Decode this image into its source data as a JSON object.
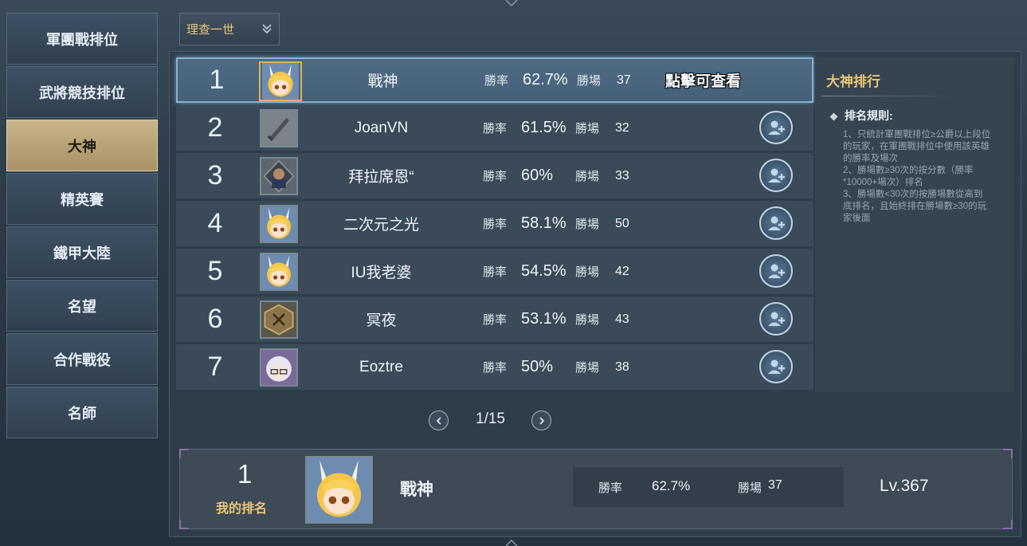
{
  "sidebar": {
    "items": [
      {
        "label": "軍團戰排位",
        "active": false
      },
      {
        "label": "武將競技排位",
        "active": false
      },
      {
        "label": "大神",
        "active": true
      },
      {
        "label": "精英賽",
        "active": false
      },
      {
        "label": "鐵甲大陸",
        "active": false
      },
      {
        "label": "名望",
        "active": false
      },
      {
        "label": "合作戰役",
        "active": false
      },
      {
        "label": "名師",
        "active": false
      }
    ]
  },
  "dropdown": {
    "value": "理查一世"
  },
  "ranking": {
    "rate_label": "勝率",
    "games_label": "勝場",
    "click_hint": "點擊可查看",
    "rows": [
      {
        "rank": "1",
        "name": "戰神",
        "rate": "62.7%",
        "games": "37",
        "avatar": "blonde-bunny-girl-avatar-icon"
      },
      {
        "rank": "2",
        "name": "JoanVN",
        "rate": "61.5%",
        "games": "32",
        "avatar": "sword-avatar-icon"
      },
      {
        "rank": "3",
        "name": "拜拉席恩“",
        "rate": "60%",
        "games": "33",
        "avatar": "armored-warrior-avatar-icon"
      },
      {
        "rank": "4",
        "name": "二次元之光",
        "rate": "58.1%",
        "games": "50",
        "avatar": "blonde-bunny-girl-avatar-icon"
      },
      {
        "rank": "5",
        "name": "IU我老婆",
        "rate": "54.5%",
        "games": "42",
        "avatar": "blonde-bunny-girl-avatar-icon"
      },
      {
        "rank": "6",
        "name": "冥夜",
        "rate": "53.1%",
        "games": "43",
        "avatar": "bronze-emblem-avatar-icon"
      },
      {
        "rank": "7",
        "name": "Eoztre",
        "rate": "50%",
        "games": "38",
        "avatar": "silver-hair-glasses-avatar-icon"
      }
    ]
  },
  "info": {
    "title": "大神排行",
    "rule_heading": "排名規則:",
    "rule_text": "1、只統計軍團戰排位≥公爵以上段位\n的玩家，在軍團戰排位中使用該英雄\n的勝率及場次\n2、勝場數≥30次的按分數（勝率\n*10000+場次）排名\n3、勝場數<30次的按勝場數從高到\n底排名，且始終排在勝場數≥30的玩\n家後面"
  },
  "pagination": {
    "text": "1/15"
  },
  "my_rank": {
    "rank": "1",
    "label": "我的排名",
    "name": "戰神",
    "rate_label": "勝率",
    "rate": "62.7%",
    "games_label": "勝場",
    "games": "37",
    "level": "Lv.367"
  },
  "colors": {
    "accent_gold": "#e7c67a",
    "active_tab": "#c8b48a",
    "highlight_border": "#86b2d0"
  }
}
